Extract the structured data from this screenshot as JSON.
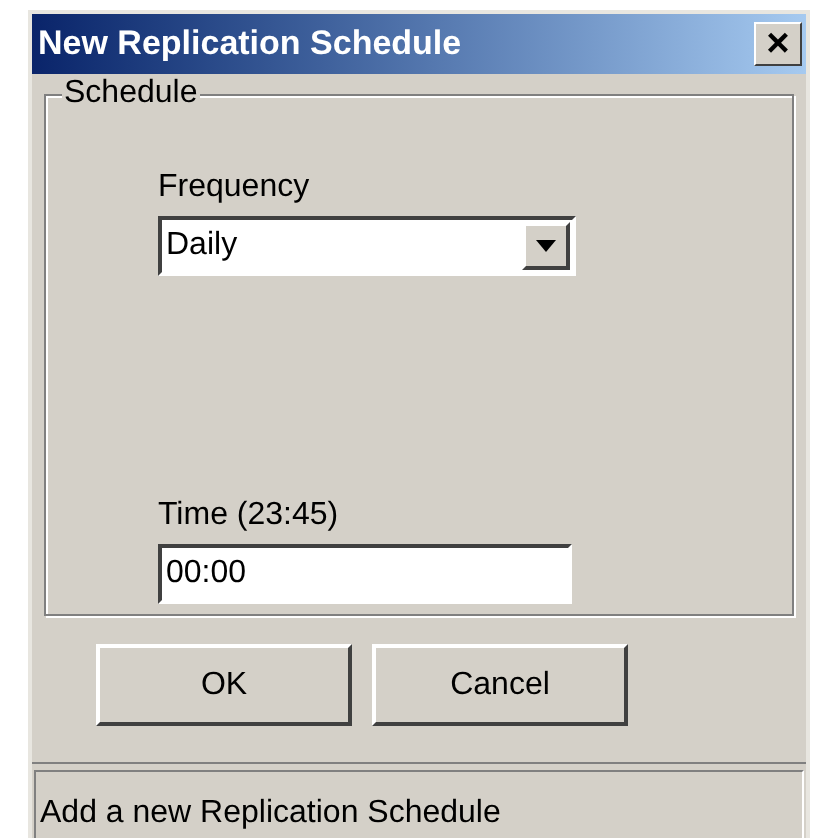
{
  "window": {
    "title": "New Replication Schedule",
    "close": "×"
  },
  "group": {
    "legend": "Schedule"
  },
  "frequency": {
    "label": "Frequency",
    "value": "Daily"
  },
  "time": {
    "label": "Time (23:45)",
    "value": "00:00"
  },
  "buttons": [
    "OK",
    "Cancel"
  ],
  "status_bar": "Add a new Replication Schedule"
}
